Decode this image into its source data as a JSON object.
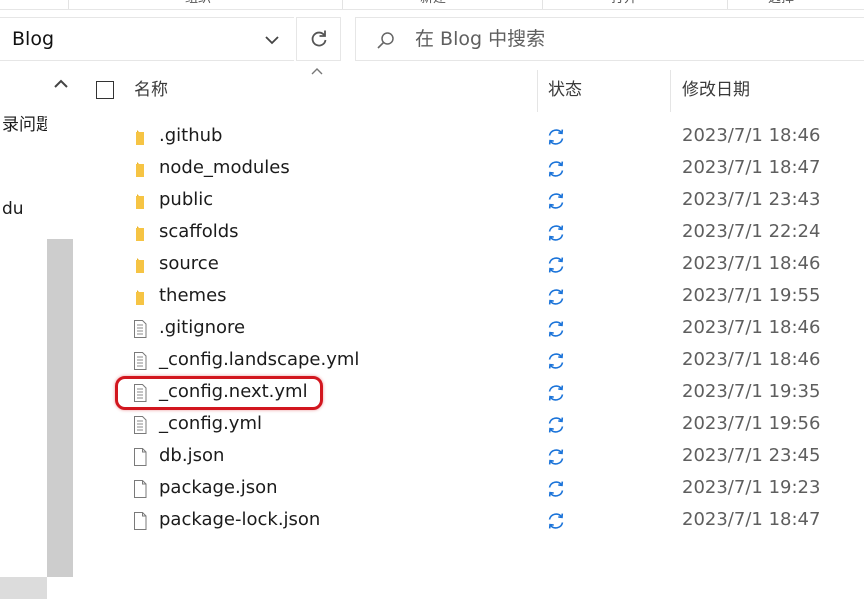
{
  "ribbon": {
    "labels": [
      "组织",
      "新建",
      "打开",
      "选择"
    ]
  },
  "address_bar": {
    "path": "Blog"
  },
  "search": {
    "placeholder": "在 Blog 中搜索"
  },
  "nav": {
    "items": [
      "录问题",
      "du"
    ]
  },
  "columns": {
    "name": "名称",
    "status": "状态",
    "modified": "修改日期"
  },
  "files": [
    {
      "name": ".github",
      "type": "folder",
      "date": "2023/7/1 18:46"
    },
    {
      "name": "node_modules",
      "type": "folder",
      "date": "2023/7/1 18:47"
    },
    {
      "name": "public",
      "type": "folder",
      "date": "2023/7/1 23:43"
    },
    {
      "name": "scaffolds",
      "type": "folder",
      "date": "2023/7/1 22:24"
    },
    {
      "name": "source",
      "type": "folder",
      "date": "2023/7/1 18:46"
    },
    {
      "name": "themes",
      "type": "folder",
      "date": "2023/7/1 19:55"
    },
    {
      "name": ".gitignore",
      "type": "text-file",
      "date": "2023/7/1 18:46"
    },
    {
      "name": "_config.landscape.yml",
      "type": "text-file",
      "date": "2023/7/1 18:46"
    },
    {
      "name": "_config.next.yml",
      "type": "text-file",
      "date": "2023/7/1 19:35",
      "highlighted": true
    },
    {
      "name": "_config.yml",
      "type": "text-file",
      "date": "2023/7/1 19:56"
    },
    {
      "name": "db.json",
      "type": "blank-file",
      "date": "2023/7/1 23:45"
    },
    {
      "name": "package.json",
      "type": "blank-file",
      "date": "2023/7/1 19:23"
    },
    {
      "name": "package-lock.json",
      "type": "blank-file",
      "date": "2023/7/1 18:47"
    }
  ],
  "status_icon": "sync-pending-icon",
  "colors": {
    "folder": "#f6c444",
    "sync": "#1a73d9",
    "highlight": "#d2161e"
  }
}
